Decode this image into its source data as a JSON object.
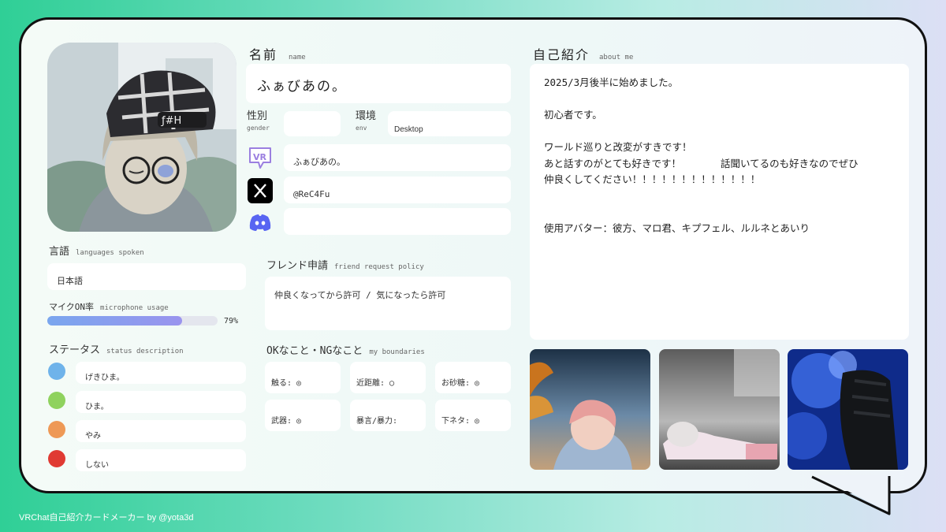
{
  "name": {
    "label": "名前",
    "label_en": "name",
    "value": "ふぁびあの。"
  },
  "gender": {
    "label": "性別",
    "label_en": "gender",
    "value": ""
  },
  "env": {
    "label": "環境",
    "label_en": "env",
    "value": "Desktop"
  },
  "social": {
    "vrchat": "ふぁびあの。",
    "x": "@ReC4Fu",
    "discord": ""
  },
  "languages": {
    "label": "言語",
    "label_en": "languages spoken",
    "value": "日本語"
  },
  "mic": {
    "label": "マイクON率",
    "label_en": "microphone usage",
    "percent": 79,
    "percent_text": "79%"
  },
  "status": {
    "label": "ステータス",
    "label_en": "status description",
    "items": [
      {
        "color": "#6fb3ea",
        "text": "げきひま。"
      },
      {
        "color": "#8fd25e",
        "text": "ひま。"
      },
      {
        "color": "#ee9956",
        "text": "やみ"
      },
      {
        "color": "#e03a33",
        "text": "しない"
      }
    ]
  },
  "friend_request": {
    "label": "フレンド申請",
    "label_en": "friend request policy",
    "value": "仲良くなってから許可 / 気になったら許可"
  },
  "boundaries": {
    "label": "OKなこと・NGなこと",
    "label_en": "my boundaries",
    "items": [
      {
        "text": "触る: ◎"
      },
      {
        "text": "近距離: ◯"
      },
      {
        "text": "お砂糖: ◎"
      },
      {
        "text": "武器: ◎"
      },
      {
        "text": "暴言/暴力:"
      },
      {
        "text": "下ネタ: ◎"
      }
    ]
  },
  "about": {
    "label": "自己紹介",
    "label_en": "about me",
    "text": "2025/3月後半に始めました。\n\n初心者です。\n\nワールド巡りと改変がすきです！\nあと話すのがとても好きです！　　　　話聞いてるのも好きなのでぜひ\n仲良くしてください！！！！！！！！！！！！！\n\n\n使用アバター：彼方、マロ君、キプフェル、ルルネとあいり"
  },
  "credit": "VRChat自己紹介カードメーカー by @yota3d",
  "icons": {
    "vrchat": "vrchat-logo-icon",
    "x": "x-logo-icon",
    "discord": "discord-logo-icon"
  },
  "colors": {
    "bar_fill": "#8a9cf0",
    "bar_track": "#e4e6ee",
    "discord": "#5865f2"
  }
}
